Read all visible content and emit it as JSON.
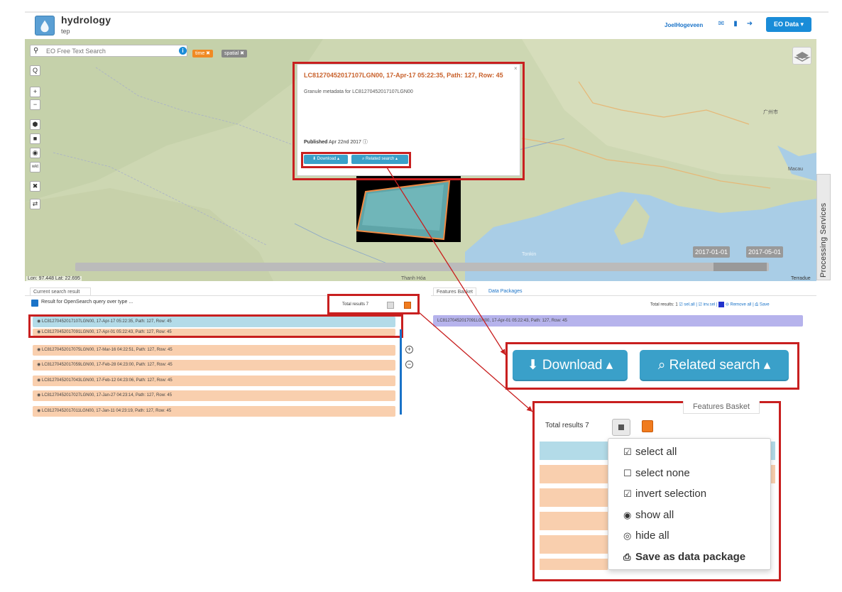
{
  "header": {
    "brand": "hydrology",
    "brand_sub": "tep",
    "user": "JoelHogeveen",
    "eo_data_label": "EO Data ▾"
  },
  "search": {
    "placeholder": "EO Free Text Search",
    "tags": [
      "time ✖",
      "spatial ✖"
    ]
  },
  "map": {
    "coords": "Lon: 97.448 Lat: 22.695",
    "attribution": "Terradue",
    "timeline_start": "2017-01-01",
    "timeline_end": "2017-05-01",
    "tools": [
      "Q",
      "+",
      "−",
      "⬢",
      "■",
      "◉",
      "wkt",
      "✖",
      "⇄"
    ],
    "labels": [
      "Macau",
      "Thanh Hóa",
      "Tonkin",
      "广州市"
    ]
  },
  "popup": {
    "title": "LC81270452017107LGN00, 17-Apr-17 05:22:35, Path: 127, Row: 45",
    "close": "×",
    "description": "Granule metadata for LC81270452017107LGN00",
    "published_label": "Published",
    "published_date": "Apr 22nd 2017 ⓘ",
    "download_label": "⬇ Download ▴",
    "related_label": "⌕ Related search ▴"
  },
  "processing_services": "Processing Services",
  "results": {
    "tab": "Current search result",
    "query": "Result for OpenSearch query over type ...",
    "total": "Total results 7",
    "rows": [
      "◉ LC81270452017107LGN00, 17-Apr-17 05:22:35, Path: 127, Row: 45",
      "◉ LC81270452017091LGN00, 17-Apr-01 05:22:43, Path: 127, Row: 45",
      "◉ LC81270452017075LGN00, 17-Mar-16 04:22:51, Path: 127, Row: 45",
      "◉ LC81270452017059LGN00, 17-Feb-28 04:23:00, Path: 127, Row: 45",
      "◉ LC81270452017043LGN00, 17-Feb-12 04:23:06, Path: 127, Row: 45",
      "◉ LC81270452017027LGN00, 17-Jan-27 04:23:14, Path: 127, Row: 45",
      "◉ LC81270452017011LGN00, 17-Jan-11 04:23:19, Path: 127, Row: 45"
    ]
  },
  "basket": {
    "tab_features": "Features Basket",
    "tab_packages": "Data Packages",
    "total": "Total results: 1",
    "actions": "☑ sel.all | ☑ inv.sel | ",
    "remove": "⊖ Remove all | ⎙ Save",
    "row": "LC81270452017091LGN00, 17-Apr-01 05:22:43, Path: 127, Row: 45"
  },
  "zoom": {
    "download_label": "⬇ Download ▴",
    "related_label": "⌕ Related search ▴",
    "total": "Total results  7",
    "features_tab": "Features Basket",
    "menu": [
      {
        "glyph": "☑",
        "label": "select all"
      },
      {
        "glyph": "☐",
        "label": "select none"
      },
      {
        "glyph": "☑",
        "label": "invert selection"
      },
      {
        "glyph": "◉",
        "label": "show all"
      },
      {
        "glyph": "◎",
        "label": "hide all"
      },
      {
        "glyph": "⎙",
        "label": "Save as data package"
      }
    ]
  },
  "colors": {
    "accent": "#1a8cd8",
    "highlight": "#c81f1f",
    "row_orange": "#f9cfae",
    "row_blue": "#b3dbe8",
    "basket_row": "#b6b3ec"
  }
}
